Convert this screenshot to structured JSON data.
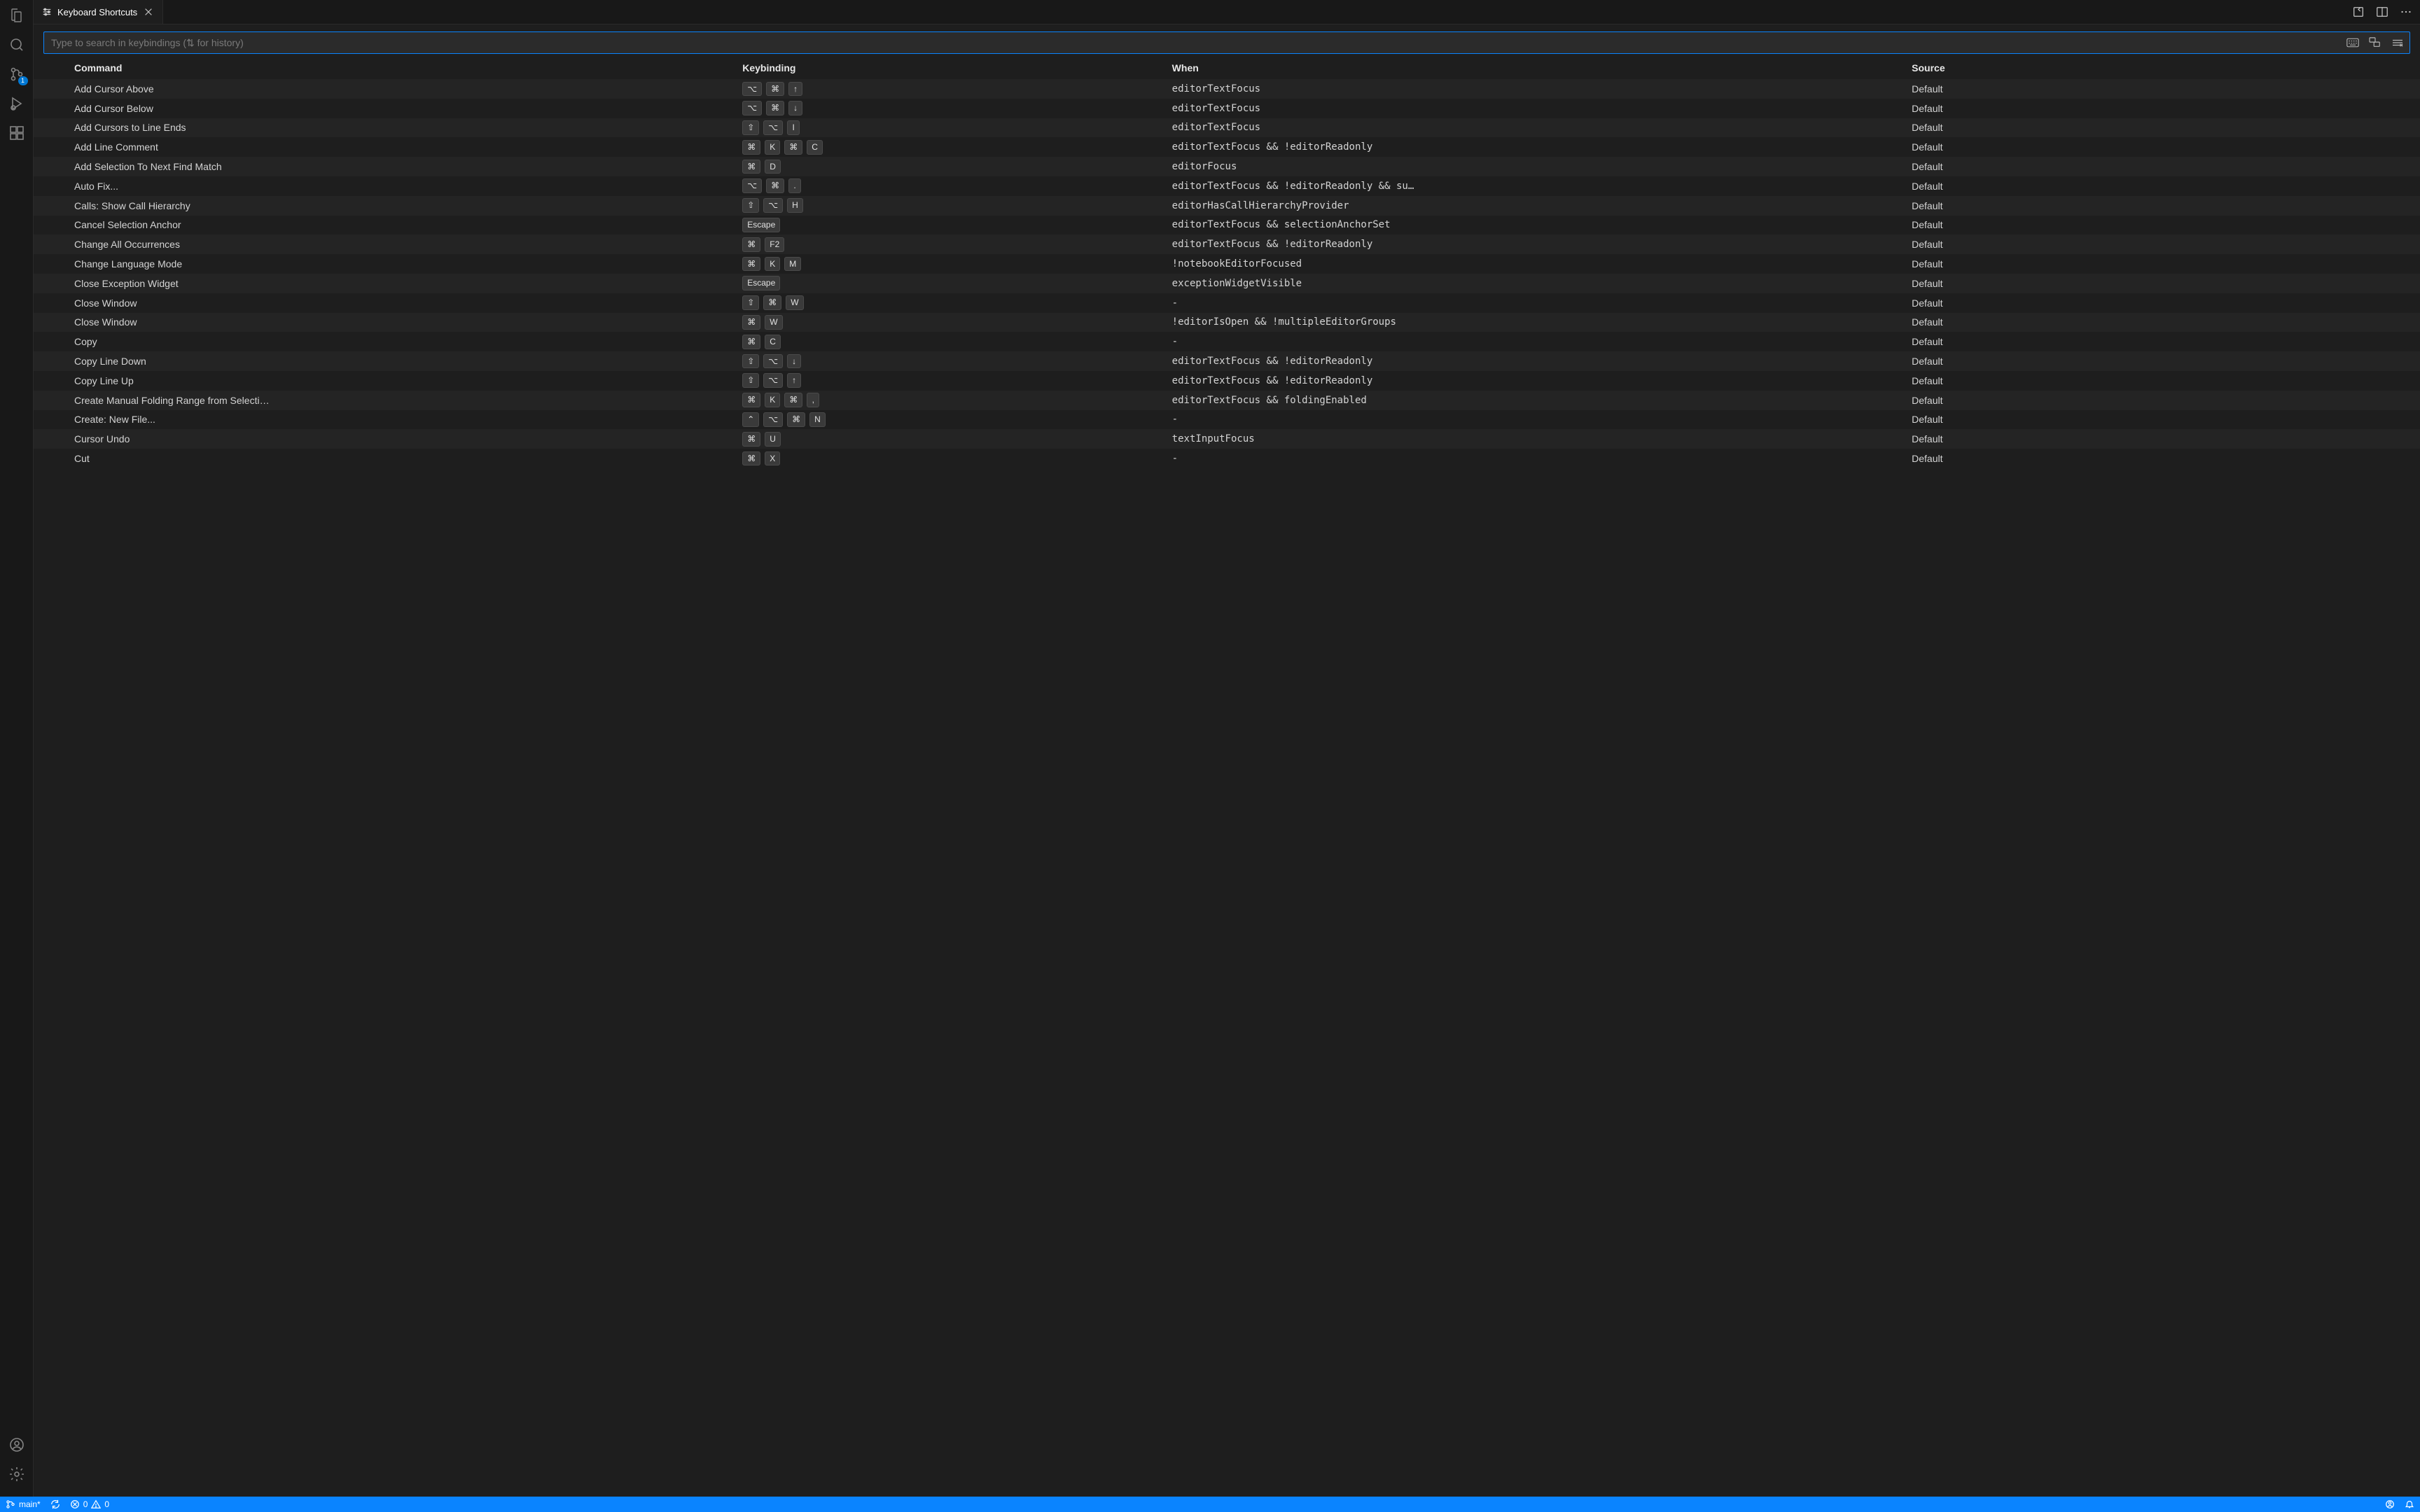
{
  "tab": {
    "title": "Keyboard Shortcuts"
  },
  "search": {
    "placeholder": "Type to search in keybindings (⇅ for history)"
  },
  "activity": {
    "scm_badge": "1"
  },
  "columns": {
    "command": "Command",
    "keybinding": "Keybinding",
    "when": "When",
    "source": "Source"
  },
  "rows": [
    {
      "command": "Add Cursor Above",
      "keys": [
        "⌥",
        "⌘",
        "↑"
      ],
      "when": "editorTextFocus",
      "source": "Default"
    },
    {
      "command": "Add Cursor Below",
      "keys": [
        "⌥",
        "⌘",
        "↓"
      ],
      "when": "editorTextFocus",
      "source": "Default"
    },
    {
      "command": "Add Cursors to Line Ends",
      "keys": [
        "⇧",
        "⌥",
        "I"
      ],
      "when": "editorTextFocus",
      "source": "Default"
    },
    {
      "command": "Add Line Comment",
      "keys": [
        "⌘",
        "K",
        "⌘",
        "C"
      ],
      "when": "editorTextFocus && !editorReadonly",
      "source": "Default"
    },
    {
      "command": "Add Selection To Next Find Match",
      "keys": [
        "⌘",
        "D"
      ],
      "when": "editorFocus",
      "source": "Default"
    },
    {
      "command": "Auto Fix...",
      "keys": [
        "⌥",
        "⌘",
        "."
      ],
      "when": "editorTextFocus && !editorReadonly && su…",
      "source": "Default"
    },
    {
      "command": "Calls: Show Call Hierarchy",
      "keys": [
        "⇧",
        "⌥",
        "H"
      ],
      "when": "editorHasCallHierarchyProvider",
      "source": "Default"
    },
    {
      "command": "Cancel Selection Anchor",
      "keys": [
        "Escape"
      ],
      "when": "editorTextFocus && selectionAnchorSet",
      "source": "Default"
    },
    {
      "command": "Change All Occurrences",
      "keys": [
        "⌘",
        "F2"
      ],
      "when": "editorTextFocus && !editorReadonly",
      "source": "Default"
    },
    {
      "command": "Change Language Mode",
      "keys": [
        "⌘",
        "K",
        "M"
      ],
      "when": "!notebookEditorFocused",
      "source": "Default"
    },
    {
      "command": "Close Exception Widget",
      "keys": [
        "Escape"
      ],
      "when": "exceptionWidgetVisible",
      "source": "Default"
    },
    {
      "command": "Close Window",
      "keys": [
        "⇧",
        "⌘",
        "W"
      ],
      "when": "-",
      "source": "Default"
    },
    {
      "command": "Close Window",
      "keys": [
        "⌘",
        "W"
      ],
      "when": "!editorIsOpen && !multipleEditorGroups",
      "source": "Default"
    },
    {
      "command": "Copy",
      "keys": [
        "⌘",
        "C"
      ],
      "when": "-",
      "source": "Default"
    },
    {
      "command": "Copy Line Down",
      "keys": [
        "⇧",
        "⌥",
        "↓"
      ],
      "when": "editorTextFocus && !editorReadonly",
      "source": "Default"
    },
    {
      "command": "Copy Line Up",
      "keys": [
        "⇧",
        "⌥",
        "↑"
      ],
      "when": "editorTextFocus && !editorReadonly",
      "source": "Default"
    },
    {
      "command": "Create Manual Folding Range from Selecti…",
      "keys": [
        "⌘",
        "K",
        "⌘",
        ","
      ],
      "when": "editorTextFocus && foldingEnabled",
      "source": "Default"
    },
    {
      "command": "Create: New File...",
      "keys": [
        "⌃",
        "⌥",
        "⌘",
        "N"
      ],
      "when": "-",
      "source": "Default"
    },
    {
      "command": "Cursor Undo",
      "keys": [
        "⌘",
        "U"
      ],
      "when": "textInputFocus",
      "source": "Default"
    },
    {
      "command": "Cut",
      "keys": [
        "⌘",
        "X"
      ],
      "when": "-",
      "source": "Default"
    }
  ],
  "status": {
    "branch": "main*",
    "errors": "0",
    "warnings": "0"
  }
}
